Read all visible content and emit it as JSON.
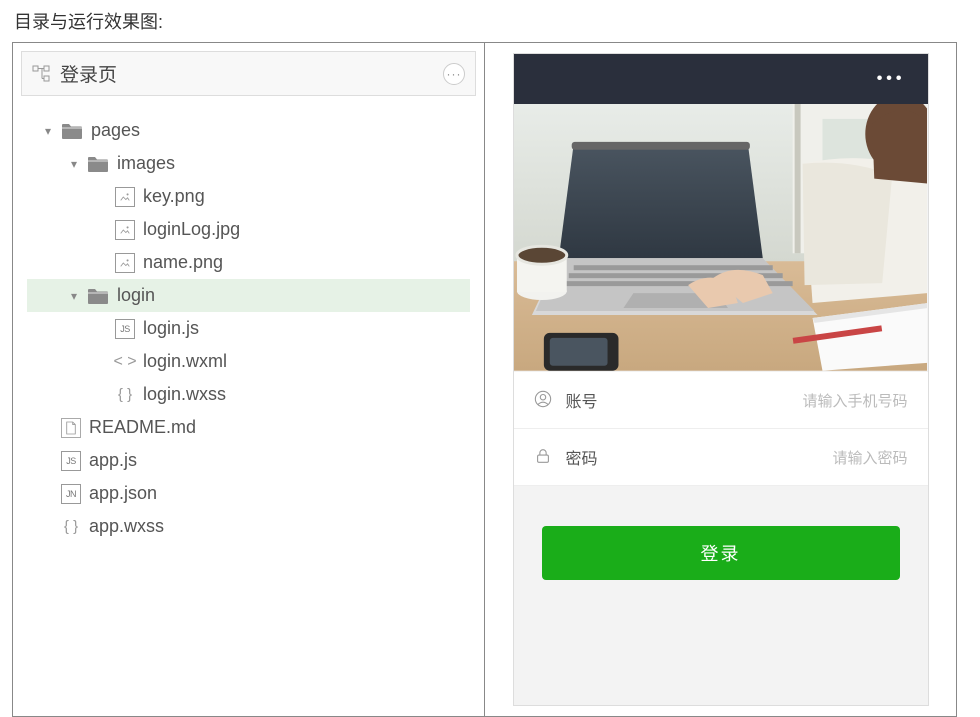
{
  "page_title": "目录与运行效果图:",
  "left": {
    "header_title": "登录页",
    "tree": [
      {
        "level": 1,
        "type": "folder",
        "name": "pages",
        "open": true,
        "selected": false
      },
      {
        "level": 2,
        "type": "folder",
        "name": "images",
        "open": true,
        "selected": false
      },
      {
        "level": 3,
        "type": "file",
        "icon": "img",
        "name": "key.png",
        "selected": false
      },
      {
        "level": 3,
        "type": "file",
        "icon": "img",
        "name": "loginLog.jpg",
        "selected": false
      },
      {
        "level": 3,
        "type": "file",
        "icon": "img",
        "name": "name.png",
        "selected": false
      },
      {
        "level": 2,
        "type": "folder",
        "name": "login",
        "open": true,
        "selected": true
      },
      {
        "level": 3,
        "type": "file",
        "icon": "js",
        "name": "login.js",
        "selected": false
      },
      {
        "level": 3,
        "type": "file",
        "icon": "wxml",
        "name": "login.wxml",
        "selected": false
      },
      {
        "level": 3,
        "type": "file",
        "icon": "wxss",
        "name": "login.wxss",
        "selected": false
      },
      {
        "level": 1,
        "type": "file",
        "icon": "doc",
        "name": "README.md",
        "selected": false
      },
      {
        "level": 1,
        "type": "file",
        "icon": "js",
        "name": "app.js",
        "selected": false
      },
      {
        "level": 1,
        "type": "file",
        "icon": "jn",
        "name": "app.json",
        "selected": false
      },
      {
        "level": 1,
        "type": "file",
        "icon": "wxss",
        "name": "app.wxss",
        "selected": false
      }
    ]
  },
  "right": {
    "form": {
      "username_label": "账号",
      "username_placeholder": "请输入手机号码",
      "password_label": "密码",
      "password_placeholder": "请输入密码"
    },
    "login_button": "登录"
  }
}
